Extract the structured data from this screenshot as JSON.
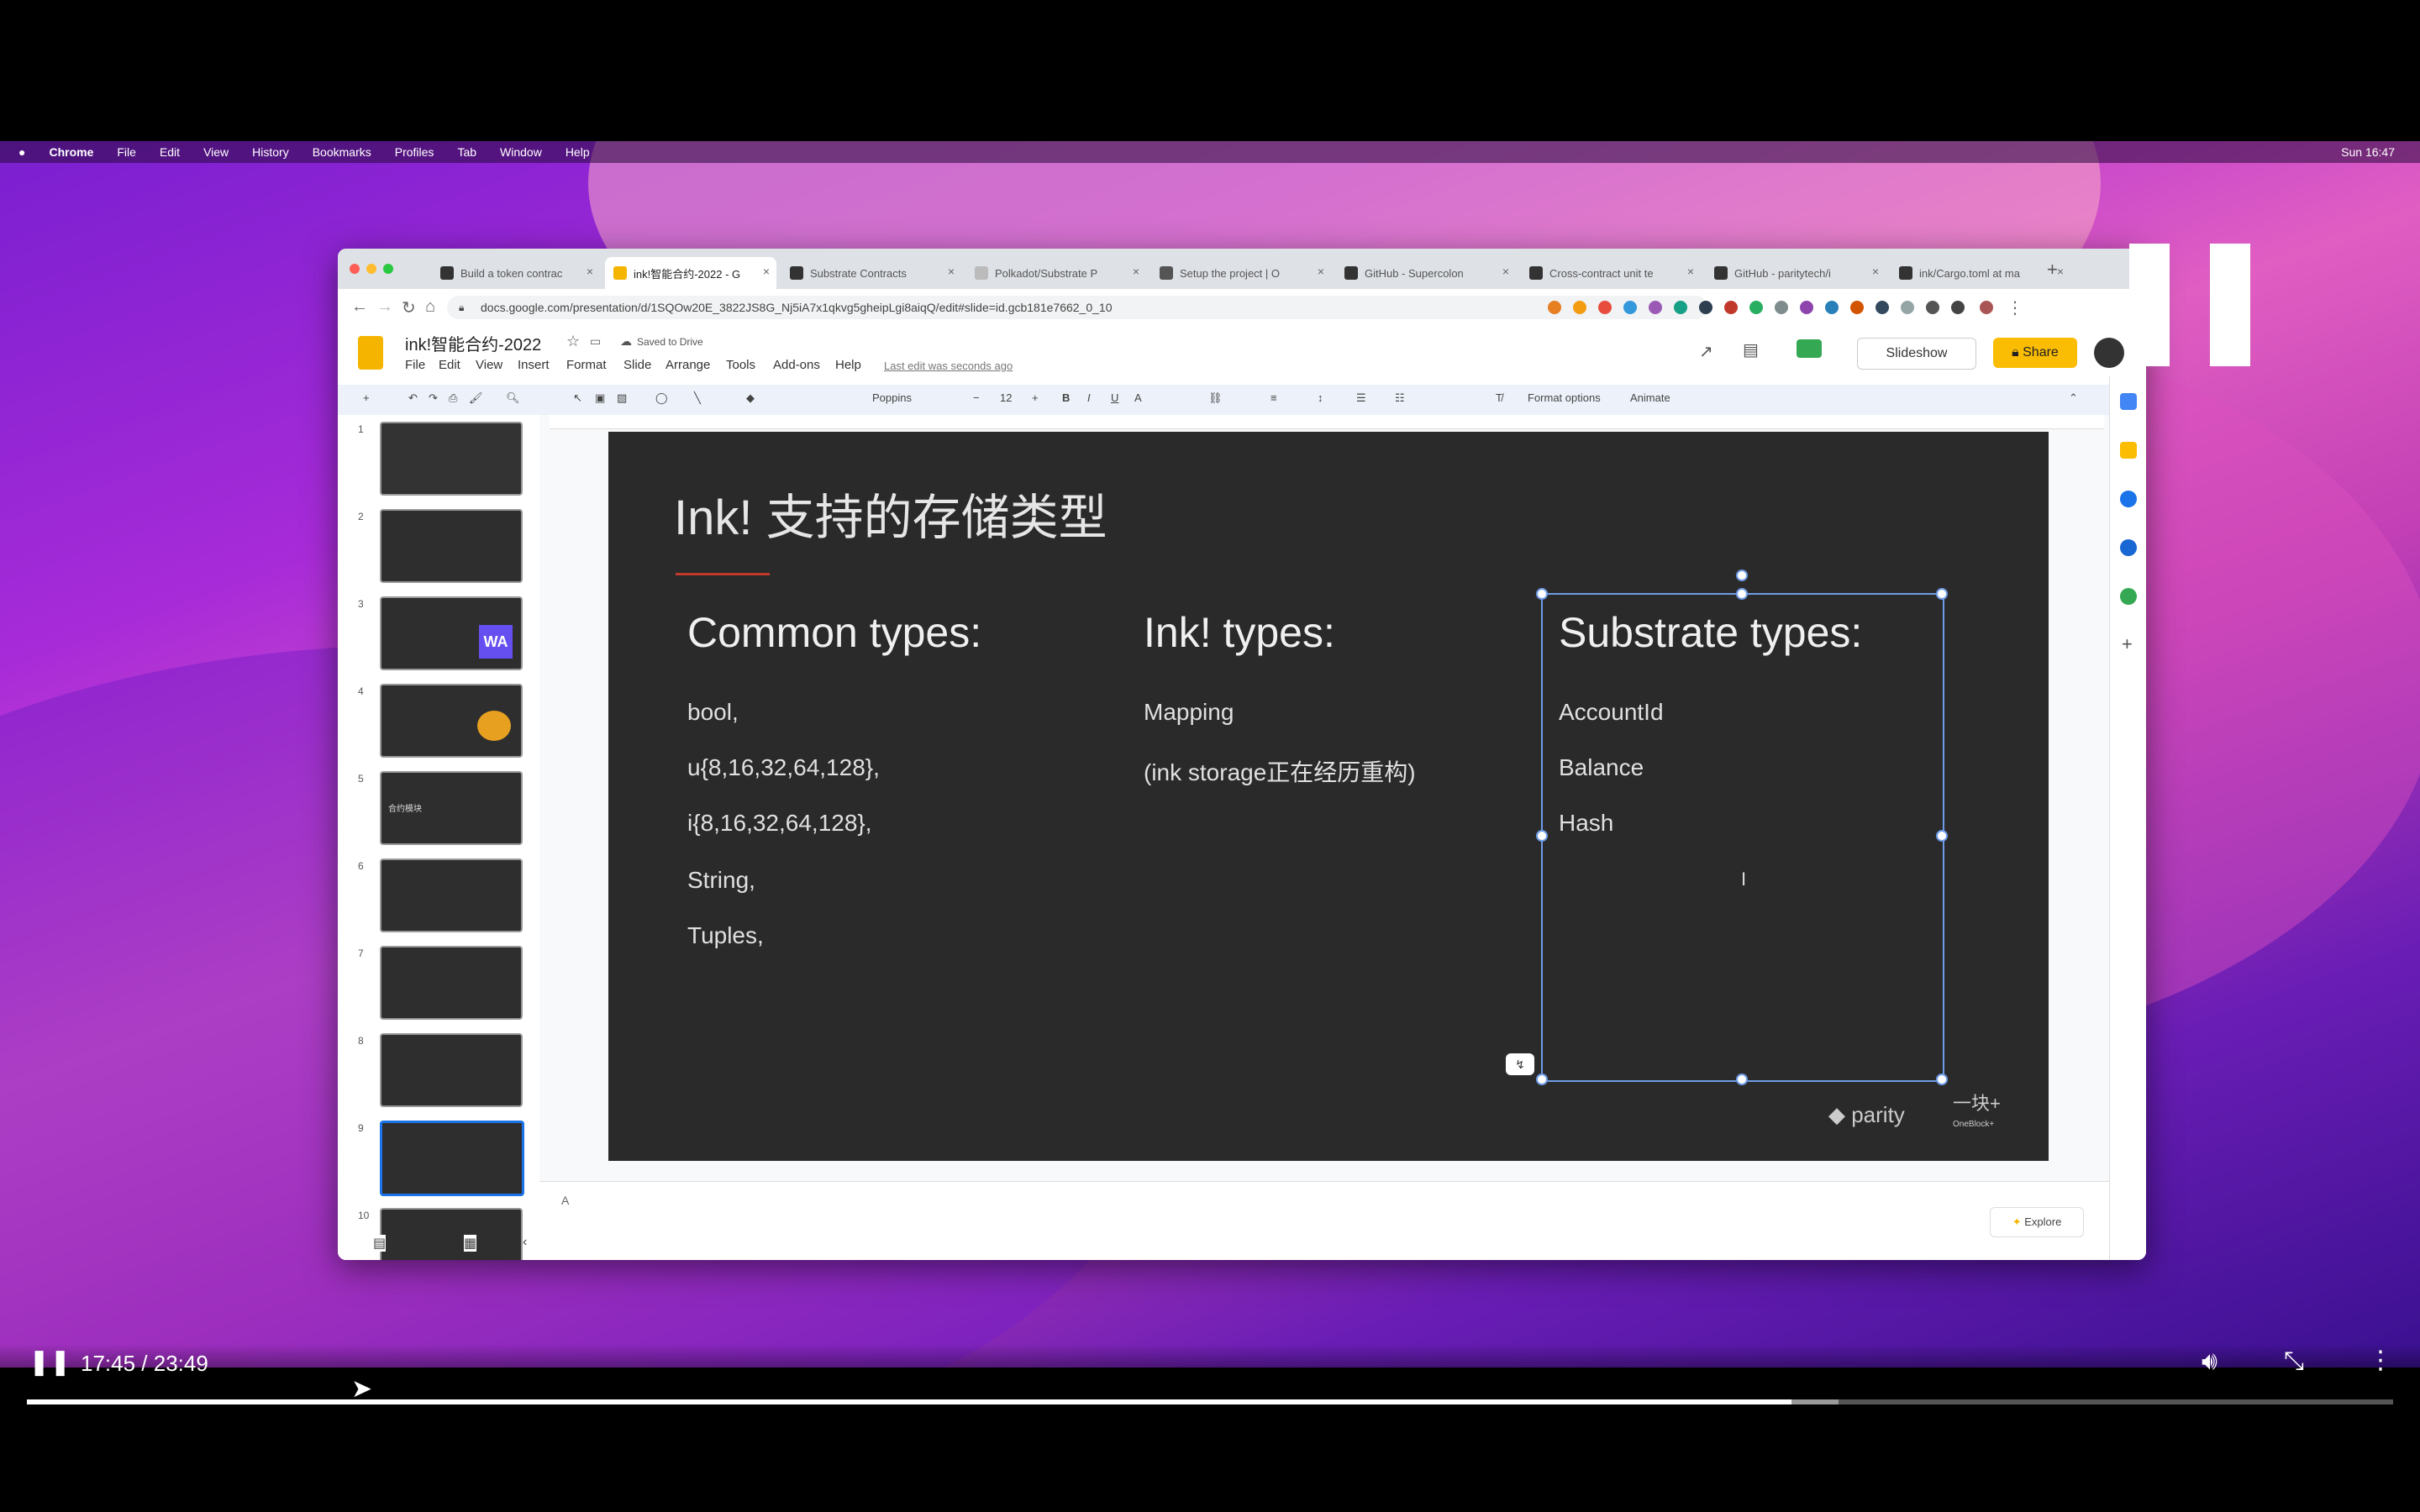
{
  "menubar": {
    "apple": "",
    "items": [
      "Chrome",
      "File",
      "Edit",
      "View",
      "History",
      "Bookmarks",
      "Profiles",
      "Tab",
      "Window",
      "Help"
    ],
    "clock": "Sun 16:47"
  },
  "browser": {
    "tabs": [
      {
        "label": "Build a token contrac"
      },
      {
        "label": "ink!智能合约-2022 - G"
      },
      {
        "label": "Substrate Contracts"
      },
      {
        "label": "Polkadot/Substrate P"
      },
      {
        "label": "Setup the project | O"
      },
      {
        "label": "GitHub - Supercolon"
      },
      {
        "label": "Cross-contract unit te"
      },
      {
        "label": "GitHub - paritytech/i"
      },
      {
        "label": "ink/Cargo.toml at ma"
      }
    ],
    "url": "docs.google.com/presentation/d/1SQOw20E_3822JS8G_Nj5iA7x1qkvg5gheipLgi8aiqQ/edit#slide=id.gcb181e7662_0_10"
  },
  "docs": {
    "title": "ink!智能合约-2022",
    "saved": "Saved to Drive",
    "menu": [
      "File",
      "Edit",
      "View",
      "Insert",
      "Format",
      "Slide",
      "Arrange",
      "Tools",
      "Add-ons",
      "Help"
    ],
    "last_edit": "Last edit was seconds ago",
    "slideshow": "Slideshow",
    "share": "Share",
    "toolbar": {
      "font": "Poppins",
      "size": "12",
      "format_options": "Format options",
      "animate": "Animate"
    }
  },
  "filmstrip": {
    "slides": [
      {
        "num": "1"
      },
      {
        "num": "2"
      },
      {
        "num": "3"
      },
      {
        "num": "4"
      },
      {
        "num": "5"
      },
      {
        "num": "6"
      },
      {
        "num": "7"
      },
      {
        "num": "8"
      },
      {
        "num": "9"
      },
      {
        "num": "10"
      }
    ],
    "thumb_wa": "WA",
    "thumb_title": "合约模块"
  },
  "slide": {
    "title": "Ink! 支持的存储类型",
    "columns": [
      {
        "heading": "Common types:",
        "items": [
          "bool,",
          "u{8,16,32,64,128},",
          "i{8,16,32,64,128},",
          "String,",
          "Tuples,"
        ]
      },
      {
        "heading": "Ink! types:",
        "items": [
          "Mapping",
          "(ink storage正在经历重构)"
        ]
      },
      {
        "heading": "Substrate types:",
        "items": [
          "AccountId",
          "Balance",
          "Hash"
        ]
      }
    ],
    "logos": {
      "parity": "parity",
      "oneblock": "一块+",
      "oneblock_sub": "OneBlock+"
    }
  },
  "notes": {
    "placeholder": "A"
  },
  "explore": "Explore",
  "video": {
    "time": "17:45 / 23:49",
    "progress": 0.7457,
    "buffered": 0.7657
  }
}
